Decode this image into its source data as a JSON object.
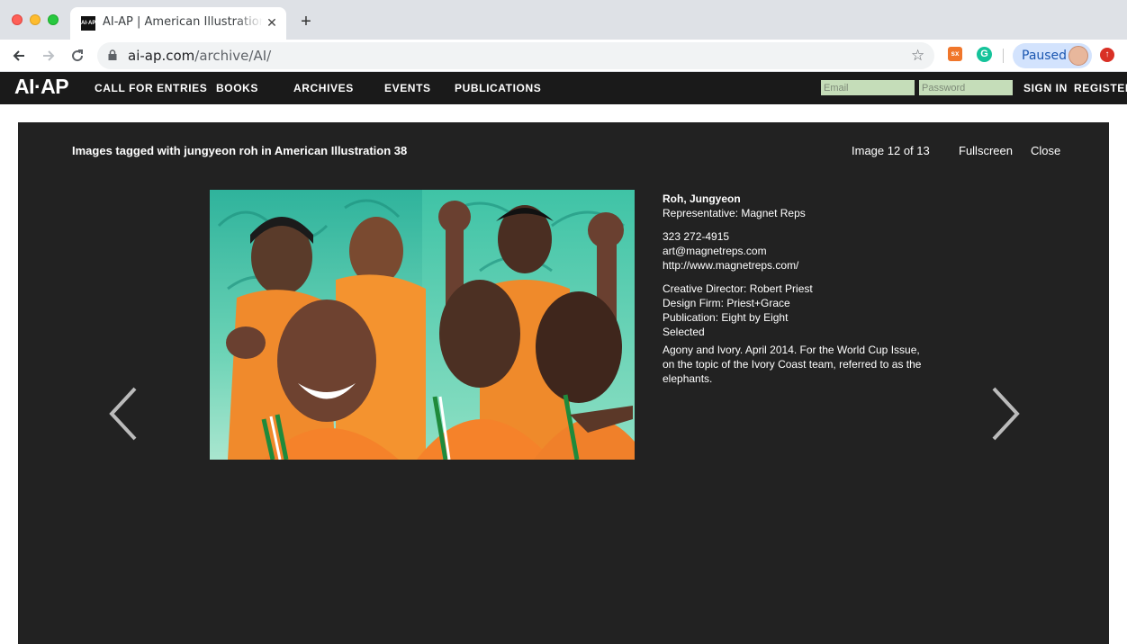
{
  "browser": {
    "tab_title": "AI-AP | American Illustration - ",
    "favicon_text": "AI·AP",
    "url_host": "ai-ap.com",
    "url_path": "/archive/AI/",
    "profile_label": "Paused",
    "extension_1": "sx",
    "extension_2": "G"
  },
  "site": {
    "logo": "AI·AP",
    "nav": [
      "CALL FOR ENTRIES",
      "BOOKS",
      "ARCHIVES",
      "EVENTS",
      "PUBLICATIONS"
    ],
    "email_placeholder": "Email",
    "password_placeholder": "Password",
    "sign_in": "SIGN IN",
    "register": "REGISTER"
  },
  "lightbox": {
    "heading": "Images tagged with jungyeon roh in American Illustration 38",
    "counter": "Image 12 of 13",
    "fullscreen": "Fullscreen",
    "close": "Close",
    "artist": "Roh, Jungyeon",
    "representative": "Representative: Magnet Reps",
    "phone": "323 272-4915",
    "email": "art@magnetreps.com",
    "website": "http://www.magnetreps.com/",
    "creative_director": "Creative Director: Robert Priest",
    "design_firm": "Design Firm: Priest+Grace",
    "publication": "Publication: Eight by Eight",
    "status": "Selected",
    "caption": "Agony and Ivory. April 2014. For the World Cup Issue, on the topic of the Ivory Coast team, referred to as the elephants."
  },
  "colors": {
    "site_bar": "#1a1a1a",
    "lightbox_bg": "#222222",
    "field_bg": "#c5ddb9",
    "profile_bg": "#d3e3fd"
  }
}
